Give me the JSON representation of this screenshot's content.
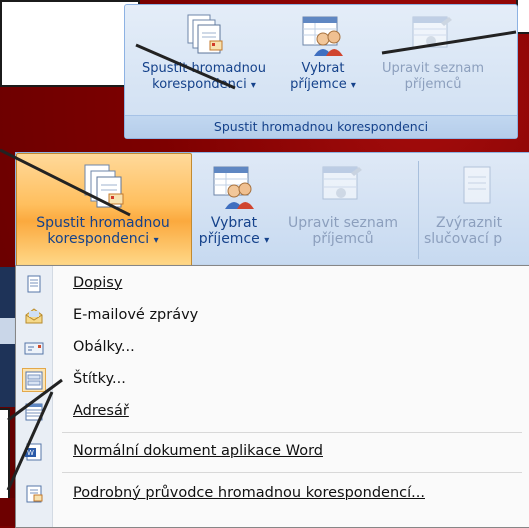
{
  "top_ribbon": {
    "start_merge_label_1": "Spustit hromadnou",
    "start_merge_label_2": "korespondenci",
    "select_recipients_label_1": "Vybrat",
    "select_recipients_label_2": "příjemce",
    "edit_list_label_1": "Upravit seznam",
    "edit_list_label_2": "příjemců",
    "dropdown_arrow": "▾",
    "group_label": "Spustit hromadnou korespondenci"
  },
  "second_ribbon": {
    "start_merge_label_1": "Spustit hromadnou",
    "start_merge_label_2": "korespondenci",
    "select_recipients_label_1": "Vybrat",
    "select_recipients_label_2": "příjemce",
    "edit_list_label_1": "Upravit seznam",
    "edit_list_label_2": "příjemců",
    "highlight_label_1": "Zvýraznit",
    "highlight_label_2": "slučovací p",
    "dropdown_arrow": "▾"
  },
  "menu": {
    "items": [
      {
        "label": "Dopisy",
        "icon": "document-icon"
      },
      {
        "label": "E-mailové zprávy",
        "icon": "envelope-open-icon"
      },
      {
        "label": "Obálky...",
        "icon": "envelope-icon"
      },
      {
        "label": "Štítky...",
        "icon": "labels-icon"
      },
      {
        "label": "Adresář",
        "icon": "directory-icon"
      },
      {
        "label": "Normální dokument aplikace Word",
        "icon": "word-document-icon"
      },
      {
        "label": "Podrobný průvodce hromadnou korespondencí...",
        "icon": "wizard-icon"
      }
    ]
  },
  "colors": {
    "background": "#7a0000",
    "ribbon_text": "#15428b",
    "active_button": "#ffbf5e"
  }
}
